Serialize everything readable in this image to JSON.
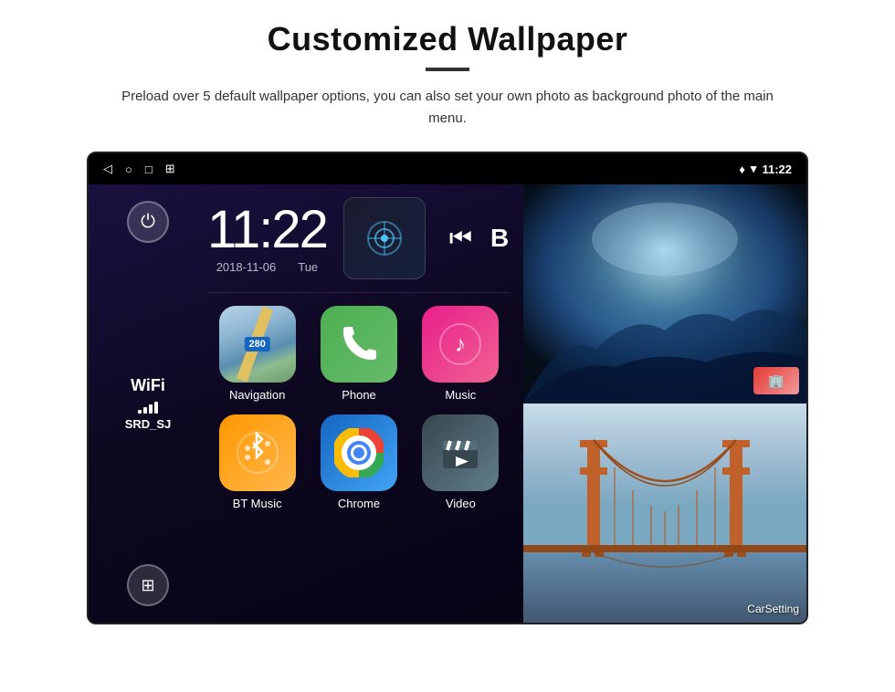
{
  "page": {
    "title": "Customized Wallpaper",
    "subtitle": "Preload over 5 default wallpaper options, you can also set your own photo as background photo of the main menu.",
    "divider": "—"
  },
  "status_bar": {
    "time": "11:22",
    "nav_back": "◁",
    "nav_home": "○",
    "nav_recent": "□",
    "nav_screenshot": "⊞",
    "location_icon": "♦",
    "wifi_icon": "▾",
    "time_display": "11:22"
  },
  "clock": {
    "time": "11:22",
    "date_left": "2018-11-06",
    "date_right": "Tue"
  },
  "sidebar": {
    "power_label": "⏻",
    "wifi_label": "WiFi",
    "wifi_network": "SRD_SJ",
    "apps_icon": "⊞"
  },
  "apps": [
    {
      "id": "navigation",
      "label": "Navigation",
      "type": "navigation"
    },
    {
      "id": "phone",
      "label": "Phone",
      "type": "phone"
    },
    {
      "id": "music",
      "label": "Music",
      "type": "music"
    },
    {
      "id": "btmusic",
      "label": "BT Music",
      "type": "btmusic"
    },
    {
      "id": "chrome",
      "label": "Chrome",
      "type": "chrome"
    },
    {
      "id": "video",
      "label": "Video",
      "type": "video"
    }
  ],
  "wallpapers": {
    "top_label": "",
    "bottom_label": "CarSetting"
  },
  "media": {
    "prev_icon": "⏮",
    "next_icon": "B"
  }
}
